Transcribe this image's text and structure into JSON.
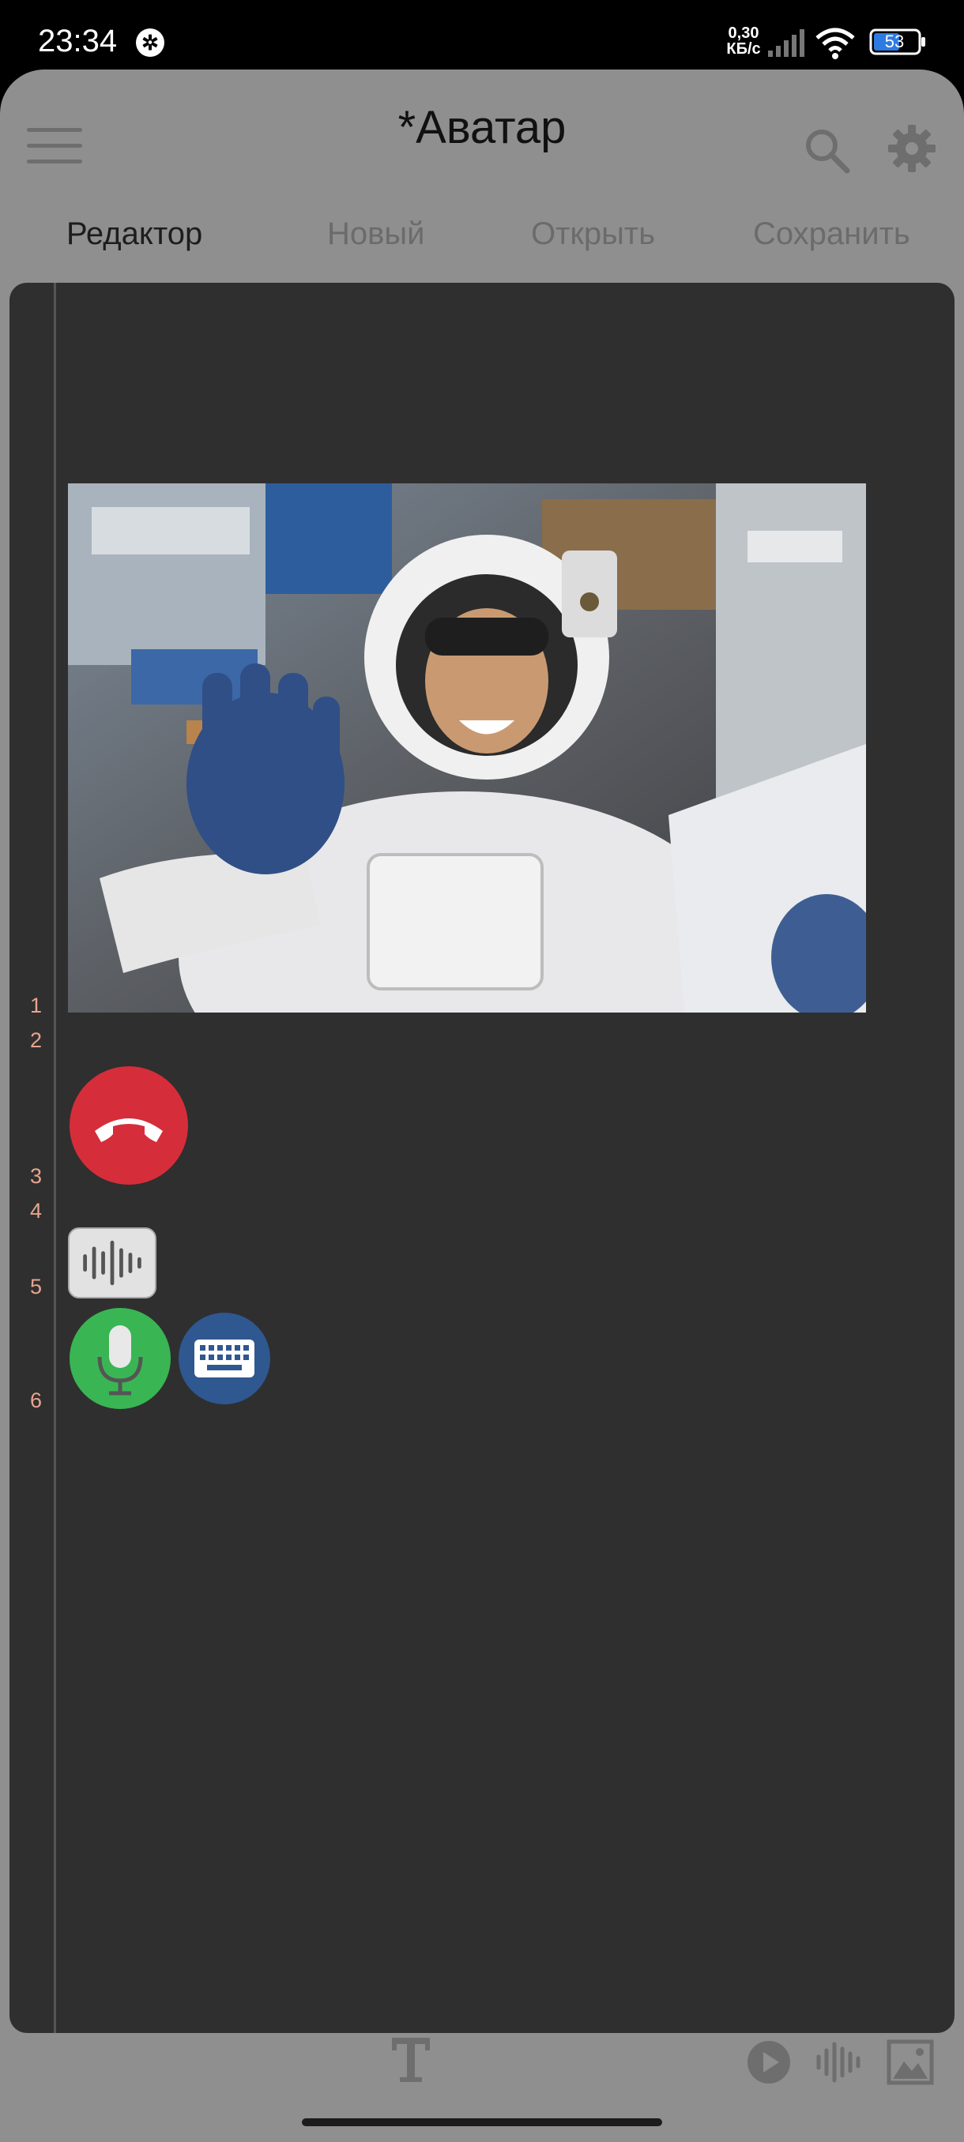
{
  "status_bar": {
    "time": "23:34",
    "network_speed_value": "0,30",
    "network_speed_unit": "КБ/с",
    "battery": "53",
    "icons": [
      "notification-badge-icon",
      "signal-icon",
      "wifi-icon",
      "battery-icon"
    ]
  },
  "app": {
    "title": "*Аватар",
    "icons": [
      "menu-icon",
      "search-icon",
      "gear-icon"
    ]
  },
  "tabs": [
    {
      "label": "Редактор",
      "active": true
    },
    {
      "label": "Новый",
      "active": false
    },
    {
      "label": "Открыть",
      "active": false
    },
    {
      "label": "Сохранить",
      "active": false
    }
  ],
  "editor": {
    "line_numbers": [
      "1",
      "2",
      "3",
      "4",
      "5",
      "6"
    ],
    "content": [
      {
        "line": "1",
        "type": "image",
        "description_icon": "astronaut-image"
      },
      {
        "line": "3",
        "type": "button",
        "icon": "end-call-icon",
        "color": "#d62d3a"
      },
      {
        "line": "5",
        "type": "button",
        "icon": "audio-waveform-icon"
      },
      {
        "line": "6",
        "type": "button",
        "icon": "microphone-icon",
        "color": "#3ab553"
      },
      {
        "line": "6",
        "type": "button",
        "icon": "keyboard-icon",
        "color": "#2f5790"
      }
    ]
  },
  "bottom_toolbar": {
    "icons": [
      "text-icon",
      "play-icon",
      "audio-waveform-icon",
      "image-icon"
    ]
  },
  "colors": {
    "app_background": "#8f8f8f",
    "editor_background": "#2f2f2f",
    "line_number": "#e8a48f"
  }
}
